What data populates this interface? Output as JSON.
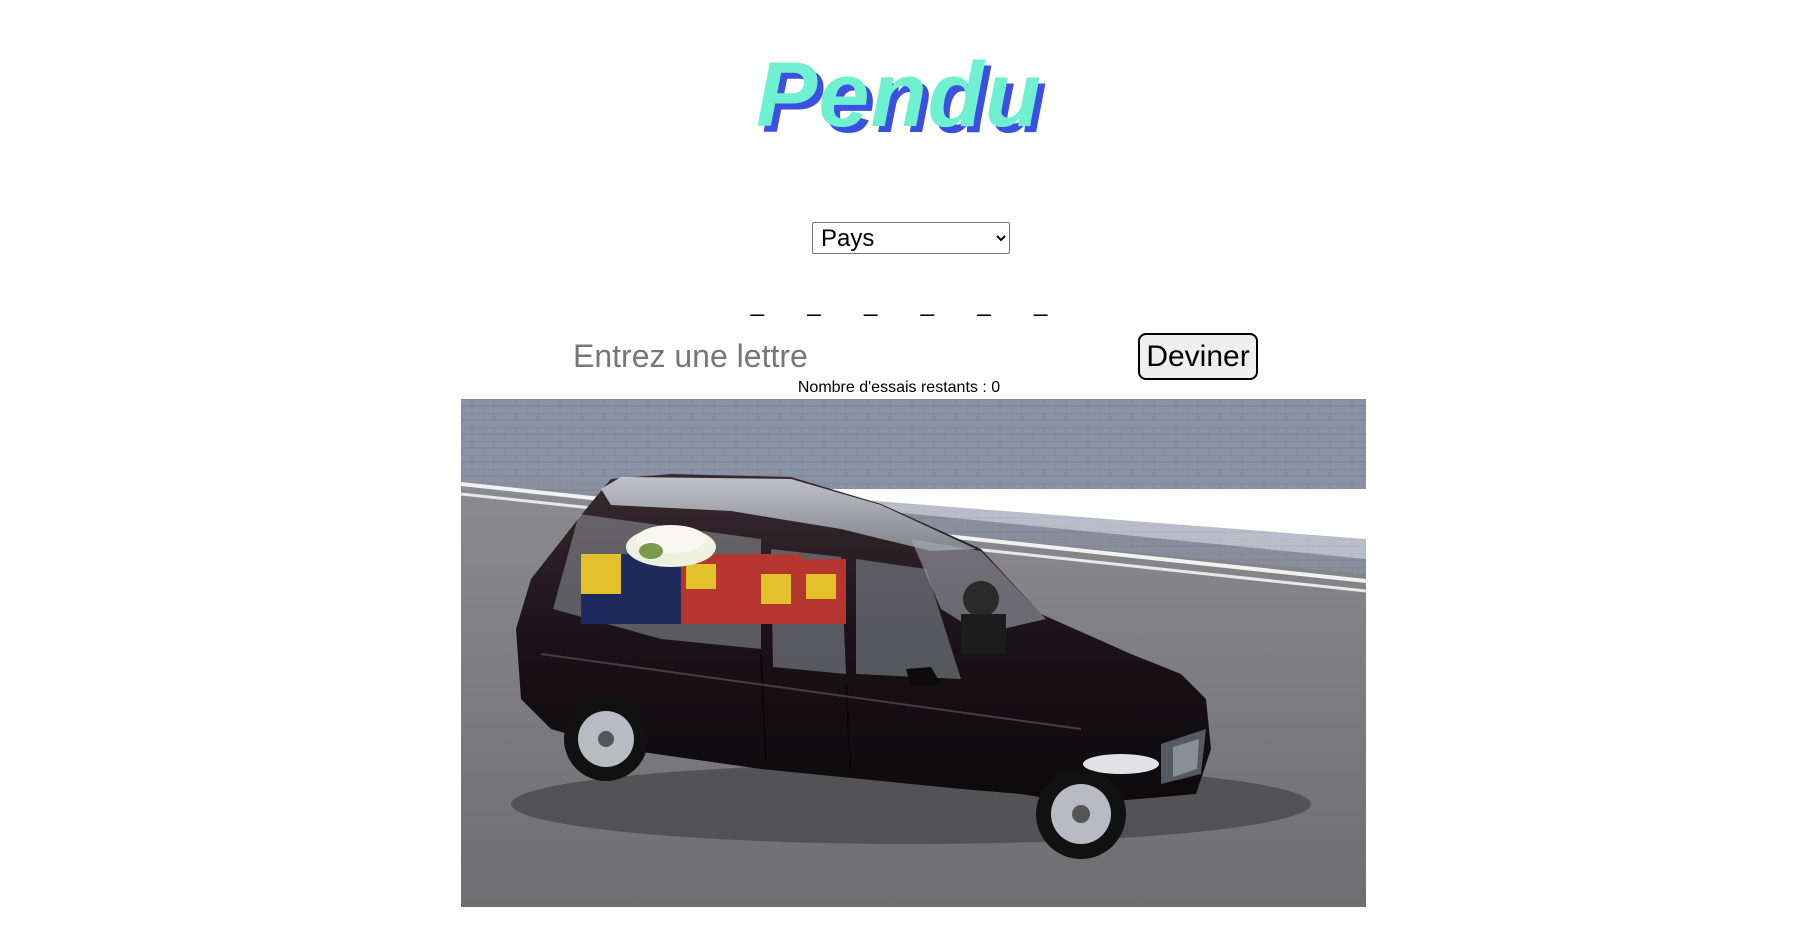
{
  "header": {
    "title": "Pendu"
  },
  "category": {
    "selected": "Pays",
    "options": [
      "Pays"
    ]
  },
  "word": {
    "slots": [
      "_",
      "_",
      "_",
      "_",
      "_",
      "_"
    ]
  },
  "guess": {
    "placeholder": "Entrez une lettre",
    "value": "",
    "button_label": "Deviner"
  },
  "status": {
    "tries_text": "Nombre d'essais restants : 0"
  },
  "colors": {
    "title_fill": "#6ff0d0",
    "title_shadow": "#3b4fe0"
  }
}
